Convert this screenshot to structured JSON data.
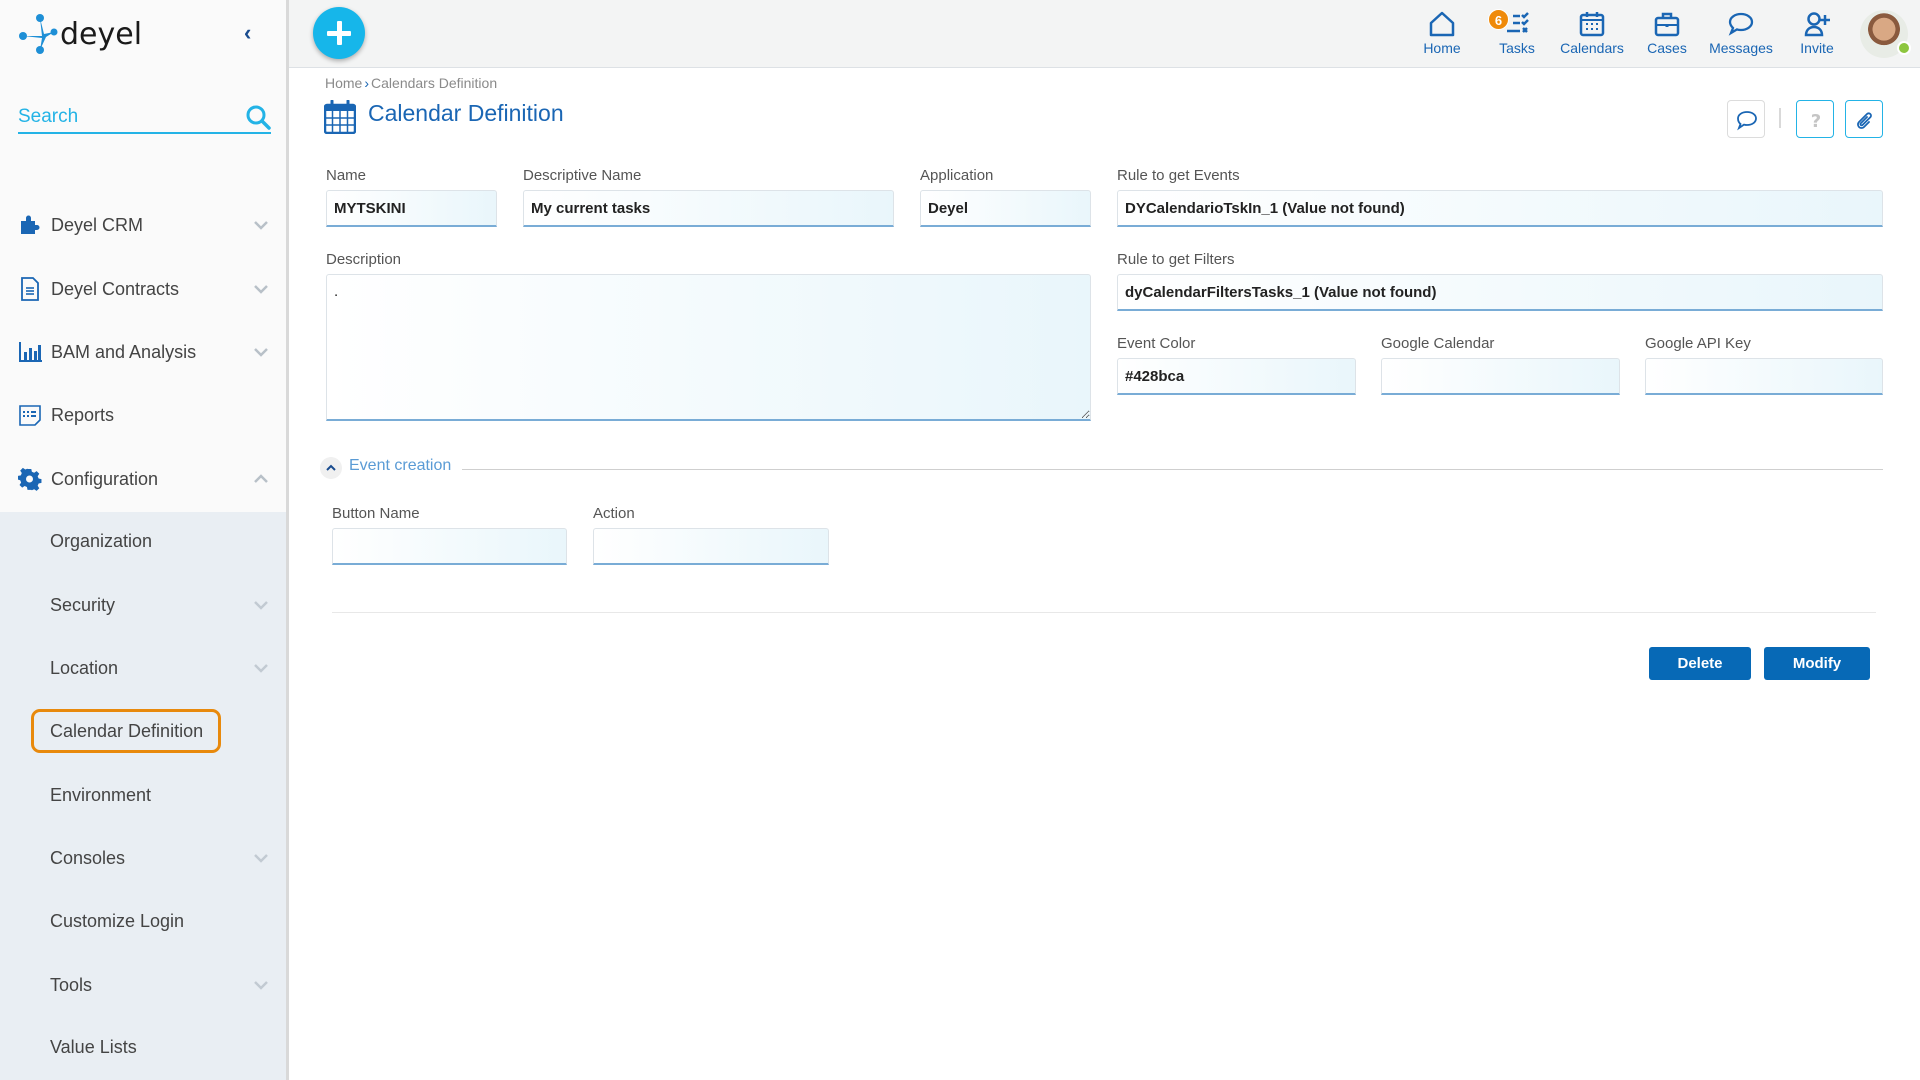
{
  "app": {
    "brand": "deyel"
  },
  "sidebar": {
    "search_placeholder": "Search",
    "items": [
      {
        "label": "Deyel CRM",
        "icon": "puzzle-icon",
        "expandable": true
      },
      {
        "label": "Deyel Contracts",
        "icon": "document-icon",
        "expandable": true
      },
      {
        "label": "BAM and Analysis",
        "icon": "bar-chart-icon",
        "expandable": true
      },
      {
        "label": "Reports",
        "icon": "report-icon",
        "expandable": false
      },
      {
        "label": "Configuration",
        "icon": "gear-icon",
        "expandable": true,
        "expanded": true
      }
    ],
    "subitems": [
      {
        "label": "Organization",
        "expandable": false
      },
      {
        "label": "Security",
        "expandable": true
      },
      {
        "label": "Location",
        "expandable": true
      },
      {
        "label": "Calendar Definition",
        "expandable": false,
        "selected": true
      },
      {
        "label": "Environment",
        "expandable": false
      },
      {
        "label": "Consoles",
        "expandable": true
      },
      {
        "label": "Customize Login",
        "expandable": false
      },
      {
        "label": "Tools",
        "expandable": true
      },
      {
        "label": "Value Lists",
        "expandable": false
      }
    ]
  },
  "topbar": {
    "nav": [
      {
        "label": "Home",
        "icon": "home-icon"
      },
      {
        "label": "Tasks",
        "icon": "tasks-icon",
        "badge": "6"
      },
      {
        "label": "Calendars",
        "icon": "calendar-icon"
      },
      {
        "label": "Cases",
        "icon": "briefcase-icon"
      },
      {
        "label": "Messages",
        "icon": "chat-icon"
      },
      {
        "label": "Invite",
        "icon": "add-user-icon"
      }
    ],
    "user_status": "online"
  },
  "header": {
    "breadcrumb": [
      "Home",
      "Calendars Definition"
    ],
    "breadcrumb_sep": "›",
    "title": "Calendar Definition"
  },
  "form": {
    "name": {
      "label": "Name",
      "value": "MYTSKINI"
    },
    "descriptive_name": {
      "label": "Descriptive Name",
      "value": "My current tasks"
    },
    "application": {
      "label": "Application",
      "value": "Deyel"
    },
    "rule_events": {
      "label": "Rule to get Events",
      "value": "DYCalendarioTskIn_1 (Value not found)"
    },
    "description": {
      "label": "Description",
      "value": "."
    },
    "rule_filters": {
      "label": "Rule to get Filters",
      "value": "dyCalendarFiltersTasks_1 (Value not found)"
    },
    "event_color": {
      "label": "Event Color",
      "value": "#428bca"
    },
    "google_calendar": {
      "label": "Google Calendar",
      "value": ""
    },
    "google_api_key": {
      "label": "Google API Key",
      "value": ""
    },
    "event_creation": {
      "title": "Event creation",
      "expanded": true,
      "button_name": {
        "label": "Button Name",
        "value": ""
      },
      "action": {
        "label": "Action",
        "value": ""
      }
    }
  },
  "actions": {
    "delete_label": "Delete",
    "modify_label": "Modify"
  },
  "colors": {
    "accent": "#16b6ea",
    "primary": "#0769b6",
    "title": "#1a66b4",
    "badge": "#ef8a0a",
    "highlight": "#e8890c"
  }
}
